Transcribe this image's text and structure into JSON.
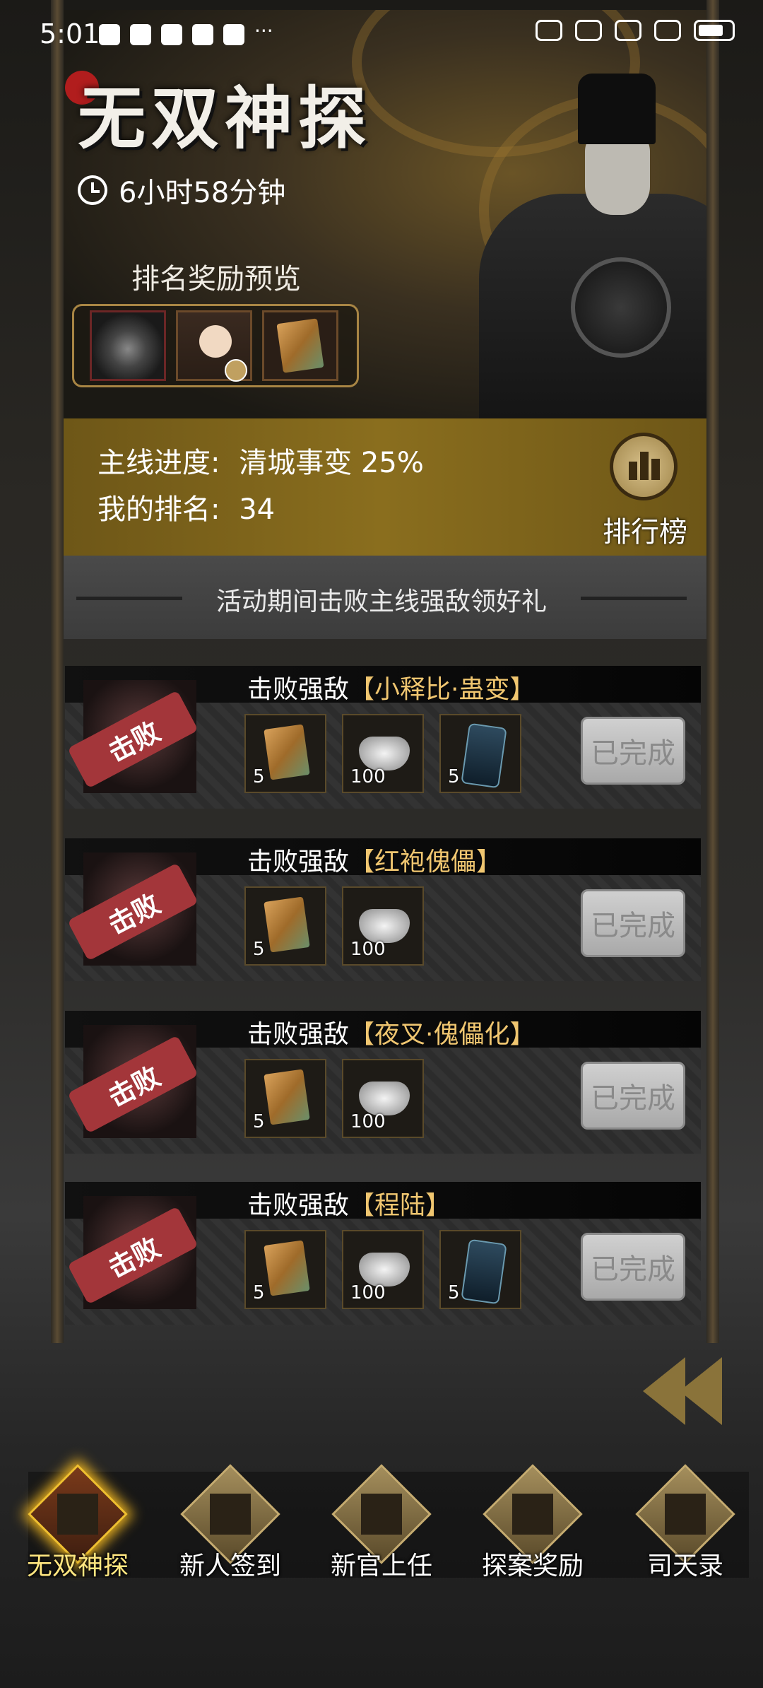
{
  "status_bar": {
    "time": "5:01",
    "left_icons": [
      "mail-icon",
      "shield-icon",
      "bulb-icon",
      "mail-icon",
      "globe-icon",
      "more-icon"
    ],
    "more": "···",
    "right_icons": [
      "eye-icon",
      "mute-bell-icon",
      "wifi-icon",
      "signal-5g-icon",
      "battery-icon"
    ]
  },
  "event": {
    "title": "无双神探",
    "countdown": "6小时58分钟",
    "ranking_preview_label": "排名奖励预览"
  },
  "progress": {
    "mainline_label": "主线进度:",
    "mainline_value": "清城事变 25%",
    "rank_label": "我的排名:",
    "rank_value": "34",
    "leaderboard_label": "排行榜"
  },
  "section_subtitle": "活动期间击败主线强敌领好礼",
  "entries": [
    {
      "title_prefix": "击败强敌",
      "enemy": "【小释比·蛊变】",
      "stamp": "击败",
      "rewards": [
        {
          "type": "book",
          "qty": "5"
        },
        {
          "type": "silver",
          "qty": "100"
        },
        {
          "type": "token",
          "qty": "5"
        }
      ],
      "button": "已完成"
    },
    {
      "title_prefix": "击败强敌",
      "enemy": "【红袍傀儡】",
      "stamp": "击败",
      "rewards": [
        {
          "type": "book",
          "qty": "5"
        },
        {
          "type": "silver",
          "qty": "100"
        }
      ],
      "button": "已完成"
    },
    {
      "title_prefix": "击败强敌",
      "enemy": "【夜叉·傀儡化】",
      "stamp": "击败",
      "rewards": [
        {
          "type": "book",
          "qty": "5"
        },
        {
          "type": "silver",
          "qty": "100"
        }
      ],
      "button": "已完成"
    },
    {
      "title_prefix": "击败强敌",
      "enemy": "【程陆】",
      "stamp": "击败",
      "rewards": [
        {
          "type": "book",
          "qty": "5"
        },
        {
          "type": "silver",
          "qty": "100"
        },
        {
          "type": "token",
          "qty": "5"
        }
      ],
      "button": "已完成"
    }
  ],
  "nav": {
    "active_index": 0,
    "items": [
      {
        "label": "无双神探",
        "icon": "detective-badge-icon"
      },
      {
        "label": "新人签到",
        "icon": "scroll-book-icon"
      },
      {
        "label": "新官上任",
        "icon": "bronze-beast-icon"
      },
      {
        "label": "探案奖励",
        "icon": "treasure-chest-icon"
      },
      {
        "label": "司天录",
        "icon": "astrolabe-icon"
      }
    ]
  },
  "colors": {
    "gold_band": "#8a6e1e",
    "title_highlight": "#f0c670",
    "stamp_red": "#a3363a",
    "active_glow": "#e8b020"
  }
}
